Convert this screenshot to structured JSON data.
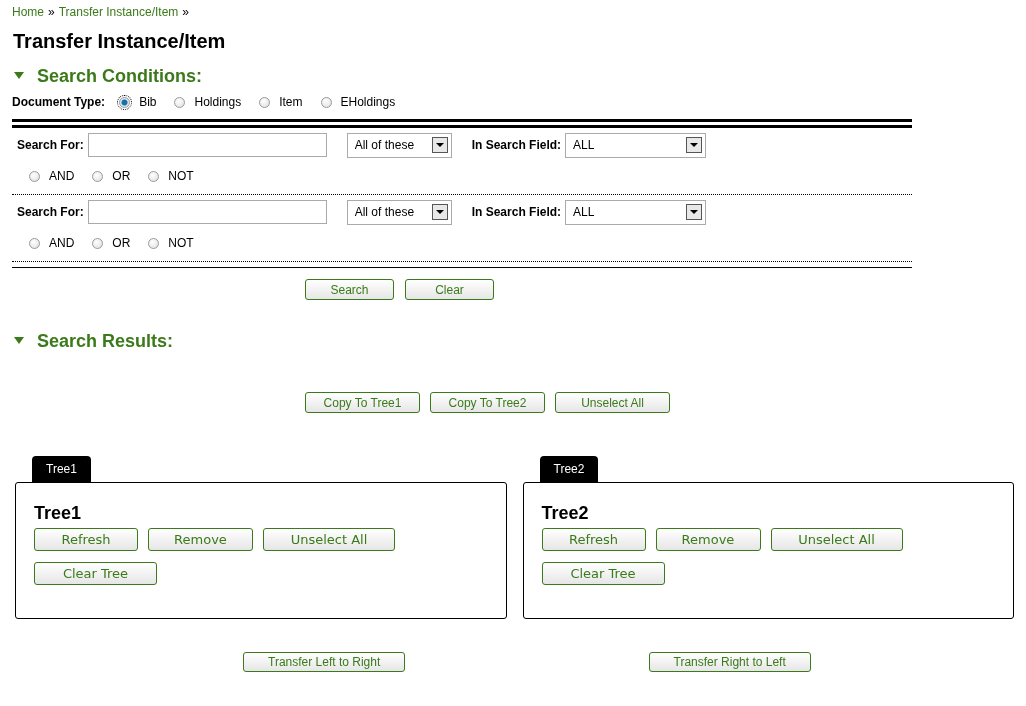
{
  "breadcrumb": [
    {
      "label": "Home",
      "separator": "»"
    },
    {
      "label": "Transfer Instance/Item",
      "separator": "»"
    }
  ],
  "title": "Transfer Instance/Item",
  "search_conditions": {
    "heading": "Search Conditions:",
    "expanded": true,
    "document_type": {
      "label": "Document Type:",
      "options": [
        {
          "label": "Bib",
          "selected": true
        },
        {
          "label": "Holdings",
          "selected": false
        },
        {
          "label": "Item",
          "selected": false
        },
        {
          "label": "EHoldings",
          "selected": false
        }
      ]
    },
    "rows": [
      {
        "label": "Search For:",
        "value": "",
        "match": "All of these",
        "field_label": "In Search Field:",
        "field": "ALL",
        "operators": [
          {
            "label": "AND",
            "selected": false
          },
          {
            "label": "OR",
            "selected": false
          },
          {
            "label": "NOT",
            "selected": false
          }
        ]
      },
      {
        "label": "Search For:",
        "value": "",
        "match": "All of these",
        "field_label": "In Search Field:",
        "field": "ALL",
        "operators": [
          {
            "label": "AND",
            "selected": false
          },
          {
            "label": "OR",
            "selected": false
          },
          {
            "label": "NOT",
            "selected": false
          }
        ]
      }
    ],
    "buttons": [
      "Search",
      "Clear"
    ]
  },
  "search_results": {
    "heading": "Search Results:",
    "expanded": true,
    "buttons": [
      "Copy To Tree1",
      "Copy To Tree2",
      "Unselect All"
    ]
  },
  "trees": [
    {
      "tab": "Tree1",
      "title": "Tree1",
      "buttons": [
        "Refresh",
        "Remove",
        "Unselect All",
        "Clear Tree"
      ],
      "transfer": "Transfer Left to Right"
    },
    {
      "tab": "Tree2",
      "title": "Tree2",
      "buttons": [
        "Refresh",
        "Remove",
        "Unselect All",
        "Clear Tree"
      ],
      "transfer": "Transfer Right to Left"
    }
  ]
}
